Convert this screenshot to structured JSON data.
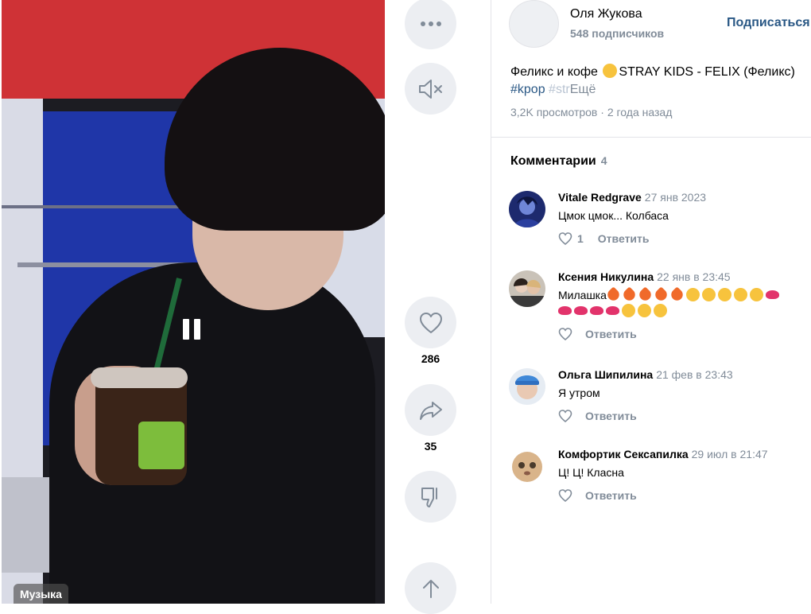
{
  "video": {
    "music_label": "Музыка"
  },
  "actions": {
    "likes": "286",
    "shares": "35"
  },
  "author": {
    "name": "Оля Жукова",
    "subscribers": "548 подписчиков",
    "subscribe_label": "Подписаться"
  },
  "post": {
    "title_pre": "Феликс и кофе",
    "title_post": "STRAY KIDS - FELIX (Феликс)",
    "tag1": "#kpop",
    "tag2": "#str",
    "more": "Ещё",
    "views": "3,2K просмотров",
    "separator": "·",
    "time": "2 года назад"
  },
  "comments": {
    "heading": "Комментарии",
    "count": "4",
    "reply_label": "Ответить",
    "items": [
      {
        "name": "Vitale Redgrave",
        "date": "27 янв 2023",
        "text": "Цмок цмок... Колбаса",
        "likes": "1"
      },
      {
        "name": "Ксения Никулина",
        "date": "22 янв в 23:45",
        "text": "Милашка"
      },
      {
        "name": "Ольга Шипилина",
        "date": "21 фев в 23:43",
        "text": "Я утром"
      },
      {
        "name": "Комфортик Сексапилка",
        "date": "29 июл в 21:47",
        "text": "Ц! Ц! Класна"
      }
    ]
  },
  "colors": {
    "link": "#2a5885",
    "secondary_text": "#818c99",
    "button_bg": "#eceef2"
  },
  "icons": [
    "more-icon",
    "mute-icon",
    "pause-icon",
    "heart-icon",
    "share-icon",
    "dislike-icon",
    "arrow-up-icon"
  ]
}
